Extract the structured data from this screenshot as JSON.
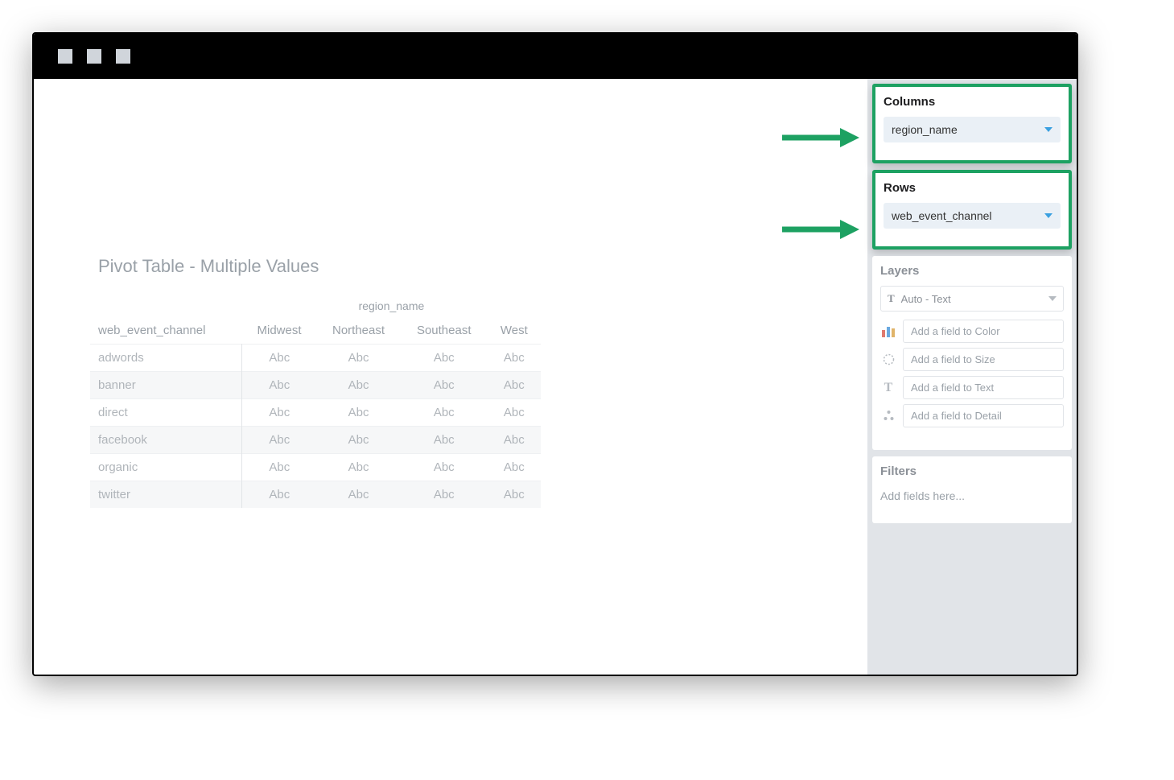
{
  "title": "Pivot Table - Multiple Values",
  "pivot": {
    "column_field": "region_name",
    "row_field": "web_event_channel",
    "columns": [
      "Midwest",
      "Northeast",
      "Southeast",
      "West"
    ],
    "rows": [
      "adwords",
      "banner",
      "direct",
      "facebook",
      "organic",
      "twitter"
    ],
    "cell_placeholder": "Abc"
  },
  "sidebar": {
    "columns": {
      "title": "Columns",
      "pill": "region_name"
    },
    "rows": {
      "title": "Rows",
      "pill": "web_event_channel"
    },
    "layers": {
      "title": "Layers",
      "select_label": "Auto - Text",
      "fields": {
        "color": "Add a field to Color",
        "size": "Add a field to Size",
        "text": "Add a field to Text",
        "detail": "Add a field to Detail"
      }
    },
    "filters": {
      "title": "Filters",
      "placeholder": "Add fields here..."
    }
  }
}
